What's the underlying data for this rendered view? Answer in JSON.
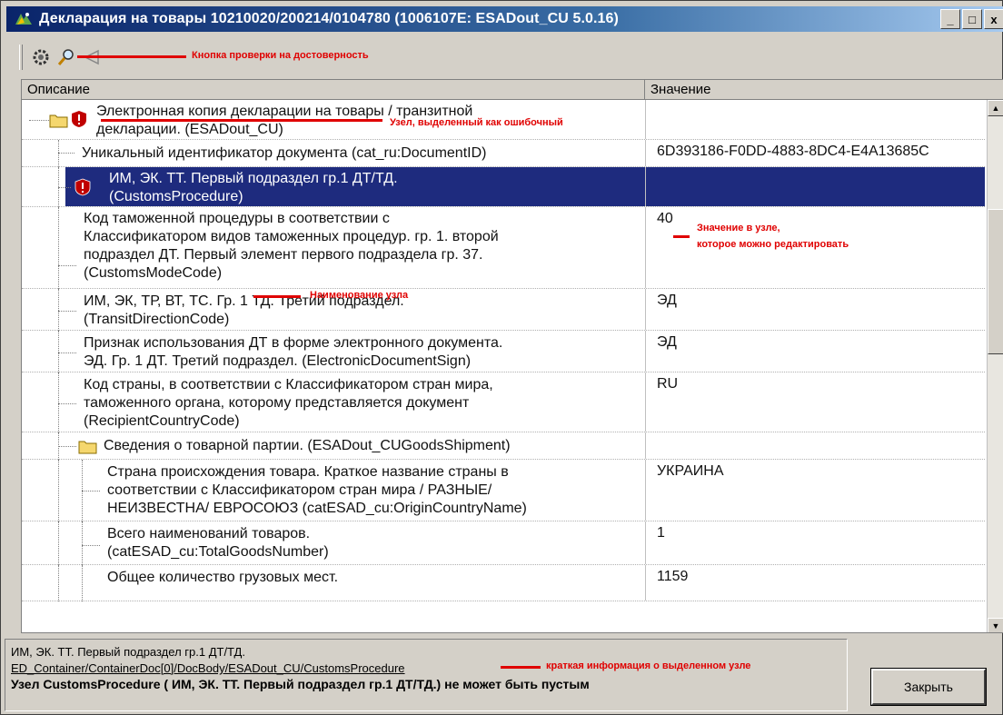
{
  "window": {
    "title": "Декларация на товары 10210020/200214/0104780 (1006107E: ESADout_CU 5.0.16)",
    "minimize": "_",
    "maximize": "□",
    "close": "x"
  },
  "toolbar": {
    "icons": [
      "gear-icon",
      "magnifier-icon",
      "back-arrow-icon"
    ],
    "annotation": "Кнопка проверки на достоверность"
  },
  "grid": {
    "columns": [
      "Описание",
      "Значение"
    ],
    "rows": [
      {
        "desc": [
          "Электронная копия  декларации на товары / транзитной",
          "декларации. (ESADout_CU)"
        ],
        "value": "",
        "icon": "folder-error",
        "level": 0
      },
      {
        "desc": [
          "Уникальный идентификатор документа (cat_ru:DocumentID)"
        ],
        "value": "6D393186-F0DD-4883-8DC4-E4A13685C",
        "level": 1
      },
      {
        "desc": [
          "ИМ, ЭК. ТТ. Первый подраздел гр.1 ДТ/ТД.",
          "(CustomsProcedure)"
        ],
        "value": "",
        "icon": "error",
        "level": 1,
        "selected": true
      },
      {
        "desc": [
          "Код таможенной процедуры в соответствии с",
          "Классификатором видов таможенных процедур.  гр. 1. второй",
          "подраздел ДТ. Первый элемент первого подраздела гр. 37.",
          "(CustomsModeCode)"
        ],
        "value": "40",
        "level": 2
      },
      {
        "desc": [
          "ИМ, ЭК, ТР, ВТ, ТС. Гр. 1 ТД. Третий подраздел.",
          "(TransitDirectionCode)"
        ],
        "value": "ЭД",
        "level": 2
      },
      {
        "desc": [
          "Признак использования ДТ в форме электронного документа.",
          "ЭД. Гр. 1 ДТ. Третий подраздел.  (ElectronicDocumentSign)"
        ],
        "value": "ЭД",
        "level": 2
      },
      {
        "desc": [
          "Код страны, в соответствии с Классификатором стран мира,",
          "таможенного органа, которому представляется документ",
          "(RecipientCountryCode)"
        ],
        "value": "RU",
        "level": 1
      },
      {
        "desc": [
          "Сведения о товарной партии. (ESADout_CUGoodsShipment)"
        ],
        "value": "",
        "icon": "folder",
        "level": 1
      },
      {
        "desc": [
          "Страна происхождения товара. Краткое название страны в",
          "соответствии с Классификатором стран мира / РАЗНЫЕ/",
          "НЕИЗВЕСТНА/ ЕВРОСОЮЗ (catESAD_cu:OriginCountryName)"
        ],
        "value": "УКРАИНА",
        "level": 2
      },
      {
        "desc": [
          "Всего наименований товаров.",
          "(catESAD_cu:TotalGoodsNumber)"
        ],
        "value": "1",
        "level": 2
      },
      {
        "desc": [
          "Общее количество грузовых мест."
        ],
        "value": "1159",
        "level": 2
      }
    ]
  },
  "annotations": {
    "error_node": "Узел, выделенный как ошибочный",
    "editable_value_1": "Значение в узле,",
    "editable_value_2": "которое можно редактировать",
    "node_name": "Наименование узла",
    "short_info": "краткая информация о выделенном узле"
  },
  "status": {
    "line1": "ИМ, ЭК. ТТ. Первый подраздел гр.1 ДТ/ТД.",
    "line2": "ED_Container/ContainerDoc[0]/DocBody/ESADout_CU/CustomsProcedure",
    "line3": "Узел CustomsProcedure ( ИМ, ЭК. ТТ. Первый подраздел гр.1 ДТ/ТД.) не может быть пустым"
  },
  "buttons": {
    "close": "Закрыть"
  },
  "colors": {
    "selected_row": "#1e2b7e",
    "annotation": "#e00000",
    "titlebar": "#0a246a"
  }
}
